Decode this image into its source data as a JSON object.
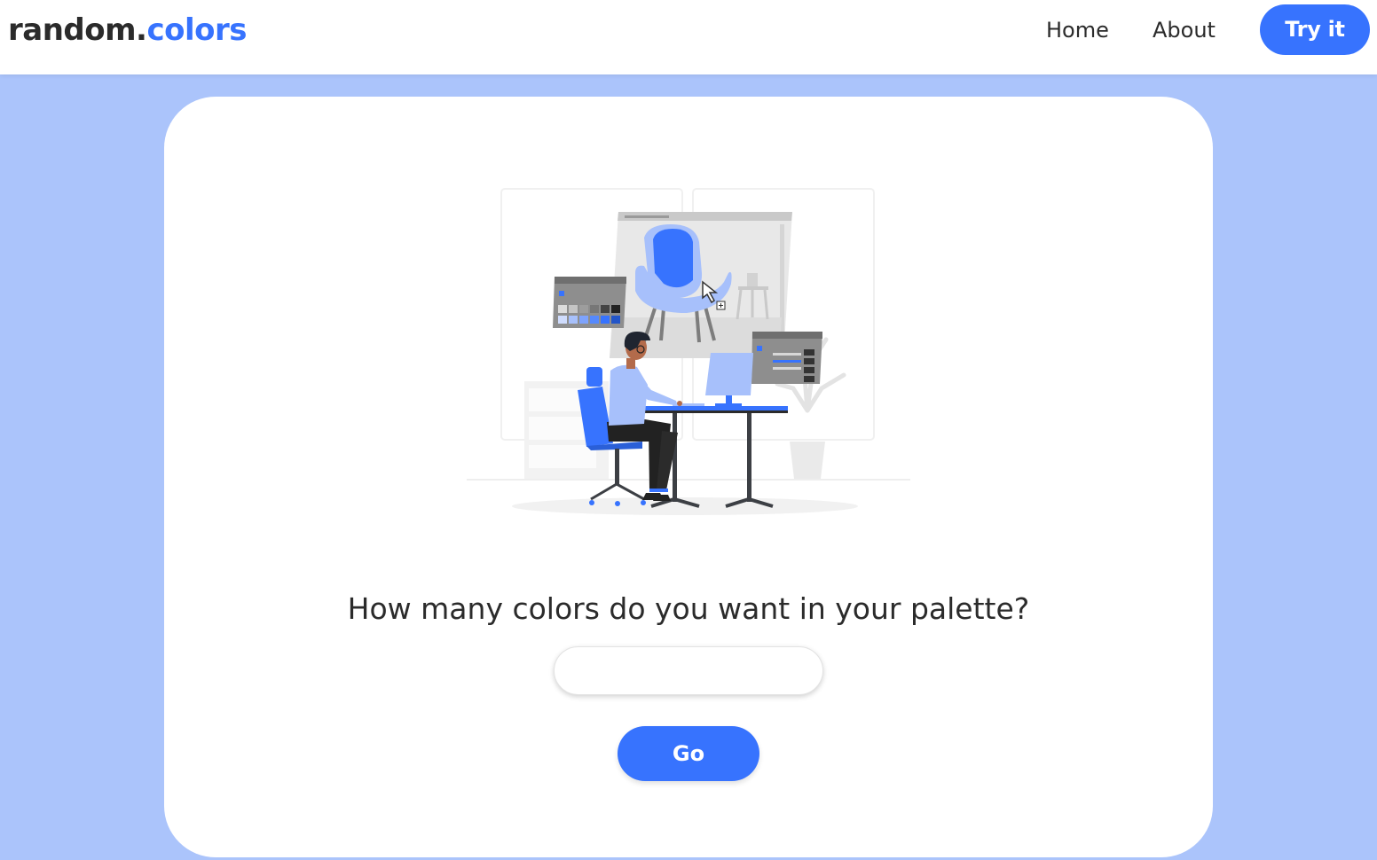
{
  "navbar": {
    "logo_main": "random.",
    "logo_accent": "colors",
    "links": {
      "home": "Home",
      "about": "About"
    },
    "cta_label": "Try it"
  },
  "main": {
    "question": "How many colors do you want in your palette?",
    "input": {
      "value": "",
      "placeholder": ""
    },
    "go_label": "Go",
    "illustration": "designer-at-desk-illustration"
  },
  "colors": {
    "accent": "#3773fe",
    "background": "#abc4fb",
    "text": "#2b2b2b",
    "card": "#ffffff"
  }
}
